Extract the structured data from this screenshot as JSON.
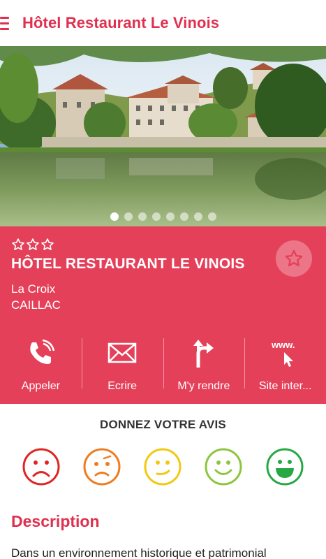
{
  "appbar": {
    "title": "Hôtel Restaurant Le Vinois"
  },
  "gallery": {
    "total_images": 8,
    "active_index": 0
  },
  "hotel": {
    "stars": 3,
    "name": "HÔTEL RESTAURANT LE VINOIS",
    "address_line1": "La Croix",
    "address_line2": "CAILLAC"
  },
  "actions": [
    {
      "label": "Appeler",
      "icon": "phone-icon"
    },
    {
      "label": "Ecrire",
      "icon": "envelope-icon"
    },
    {
      "label": "M'y rendre",
      "icon": "directions-icon"
    },
    {
      "label": "Site inter...",
      "icon": "website-icon",
      "icon_text": "www."
    }
  ],
  "review": {
    "title": "DONNEZ VOTRE AVIS"
  },
  "description": {
    "title": "Description",
    "text": "Dans un environnement historique et patrimonial"
  },
  "colors": {
    "accent": "#e0304f",
    "card": "#e5405a",
    "smiley_very_bad": "#e02424",
    "smiley_bad": "#f07c1f",
    "smiley_neutral": "#f2c811",
    "smiley_good": "#8cc63f",
    "smiley_very_good": "#27a844"
  }
}
